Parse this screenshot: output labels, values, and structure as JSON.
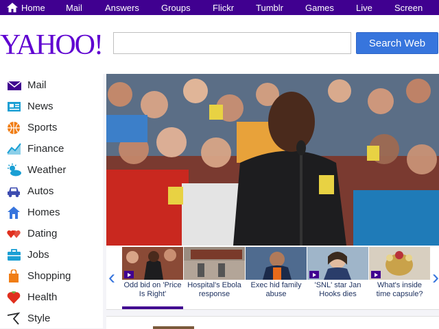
{
  "topnav": {
    "home": "Home",
    "items": [
      "Mail",
      "Answers",
      "Groups",
      "Flickr",
      "Tumblr",
      "Games",
      "Live",
      "Screen"
    ]
  },
  "logo": "YAHOO!",
  "search": {
    "placeholder": "",
    "button": "Search Web"
  },
  "sidebar": {
    "items": [
      {
        "label": "Mail",
        "icon": "envelope-icon",
        "color": "#400090"
      },
      {
        "label": "News",
        "icon": "newspaper-icon",
        "color": "#1a9fd4"
      },
      {
        "label": "Sports",
        "icon": "basketball-icon",
        "color": "#f07d15"
      },
      {
        "label": "Finance",
        "icon": "chart-line-icon",
        "color": "#1a9fd4"
      },
      {
        "label": "Weather",
        "icon": "sun-cloud-icon",
        "color": "#1a9fd4"
      },
      {
        "label": "Autos",
        "icon": "car-icon",
        "color": "#3d4cb0"
      },
      {
        "label": "Homes",
        "icon": "house-icon",
        "color": "#3775dd"
      },
      {
        "label": "Dating",
        "icon": "hearts-icon",
        "color": "#e0301e"
      },
      {
        "label": "Jobs",
        "icon": "briefcase-icon",
        "color": "#1a9fd4"
      },
      {
        "label": "Shopping",
        "icon": "shopping-bag-icon",
        "color": "#f07d15"
      },
      {
        "label": "Health",
        "icon": "heart-icon",
        "color": "#e0301e"
      },
      {
        "label": "Style",
        "icon": "hanger-icon",
        "color": "#26282a"
      }
    ]
  },
  "carousel": {
    "items": [
      {
        "caption": "Odd bid on 'Price Is Right'",
        "video": true,
        "active": true
      },
      {
        "caption": "Hospital's Ebola response",
        "video": false,
        "active": false
      },
      {
        "caption": "Exec hid family abuse",
        "video": false,
        "active": false
      },
      {
        "caption": "'SNL' star Jan Hooks dies",
        "video": true,
        "active": false
      },
      {
        "caption": "What's inside time capsule?",
        "video": true,
        "active": false
      }
    ]
  },
  "colors": {
    "brand": "#400090",
    "button": "#3775dd"
  }
}
